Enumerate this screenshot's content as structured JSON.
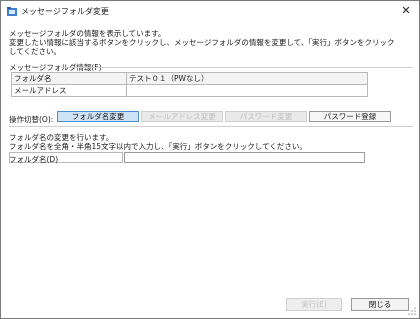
{
  "window": {
    "title": "メッセージフォルダ変更"
  },
  "intro": {
    "line1": "メッセージフォルダの情報を表示しています。",
    "line2": "変更したい情報に該当するボタンをクリックし、メッセージフォルダの情報を変更して、「実行」ボタンをクリック",
    "line3": "してください。"
  },
  "info": {
    "section_label": "メッセージフォルダ情報(F)",
    "rows": [
      {
        "key": "フォルダ名",
        "value": "テスト０１（PWなし）"
      },
      {
        "key": "メールアドレス",
        "value": ""
      }
    ]
  },
  "operation": {
    "label": "操作切替(O):",
    "tabs": [
      {
        "label": "フォルダ名変更",
        "state": "active"
      },
      {
        "label": "メールアドレス変更",
        "state": "disabled"
      },
      {
        "label": "パスワード変更",
        "state": "disabled"
      },
      {
        "label": "パスワード登録",
        "state": "normal"
      }
    ]
  },
  "description": {
    "line1": "フォルダ名の変更を行います。",
    "line2": "フォルダ名を全角・半角15文字以内で入力し、「実行」ボタンをクリックしてください。"
  },
  "field": {
    "label": "フォルダ名(D)",
    "value": ""
  },
  "footer": {
    "exec_label": "実行(E)",
    "close_label": "閉じる"
  },
  "colors": {
    "active_tab": "#cfe3f7",
    "disabled_text": "#bdbdbd"
  },
  "icons": {
    "app": "folder-app-icon",
    "close": "close-icon"
  }
}
